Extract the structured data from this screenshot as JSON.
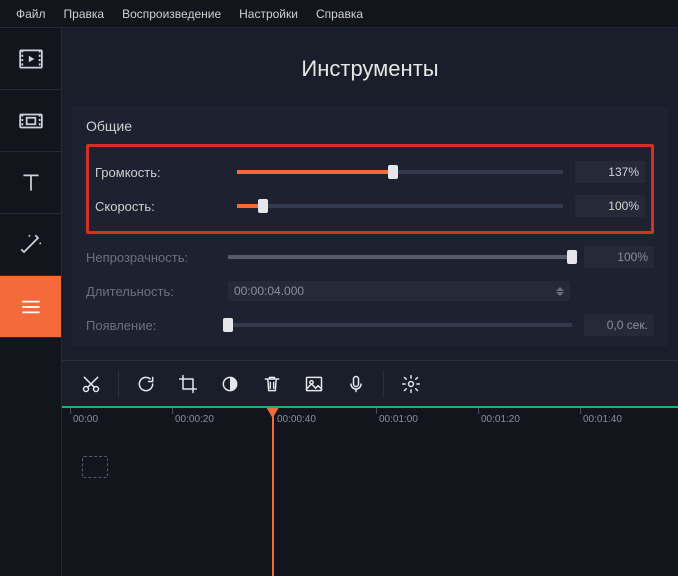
{
  "menu": {
    "file": "Файл",
    "edit": "Правка",
    "play": "Воспроизведение",
    "settings": "Настройки",
    "help": "Справка"
  },
  "panel": {
    "title": "Инструменты",
    "section": "Общие",
    "volume": {
      "label": "Громкость:",
      "value": "137%",
      "pct": 48
    },
    "speed": {
      "label": "Скорость:",
      "value": "100%",
      "pct": 8
    },
    "opacity": {
      "label": "Непрозрачность:",
      "value": "100%",
      "pct": 100
    },
    "duration": {
      "label": "Длительность:",
      "value": "00:00:04.000"
    },
    "appear": {
      "label": "Появление:",
      "value": "0,0 сек.",
      "pct": 0
    }
  },
  "timecodes": [
    "00:00",
    "00:00:20",
    "00:00:40",
    "00:01:00",
    "00:01:20",
    "00:01:40"
  ],
  "playhead_pct": 36
}
